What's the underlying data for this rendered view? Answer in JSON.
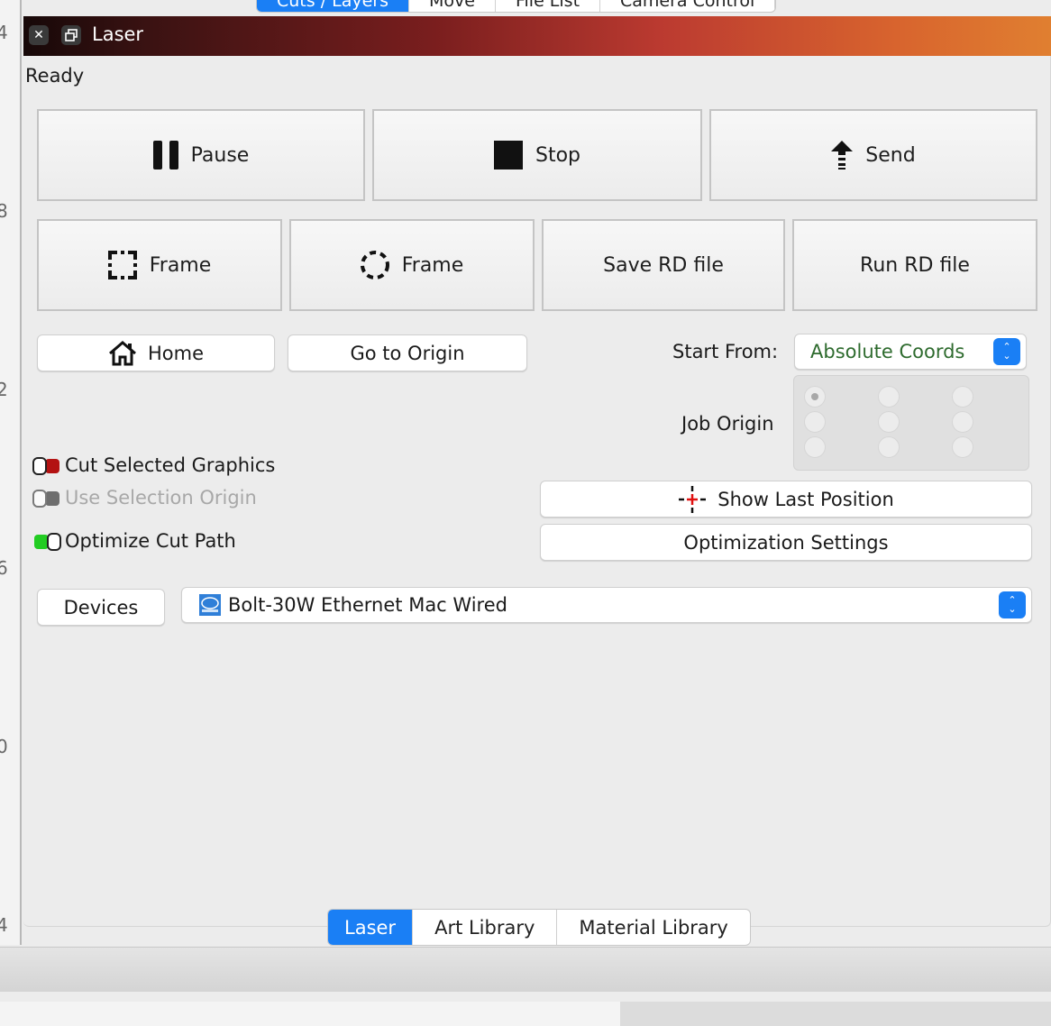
{
  "ruler": {
    "ticks": [
      "4",
      "8",
      "2",
      "6",
      "0",
      "4"
    ]
  },
  "top_tabs": [
    "Cuts / Layers",
    "Move",
    "File List",
    "Camera Control"
  ],
  "window": {
    "title": "Laser"
  },
  "status": "Ready",
  "job_buttons": {
    "pause": "Pause",
    "stop": "Stop",
    "send": "Send"
  },
  "frame_buttons": {
    "frame_rect": "Frame",
    "frame_circle": "Frame",
    "save_rd": "Save RD file",
    "run_rd": "Run RD file"
  },
  "nav_buttons": {
    "home": "Home",
    "go_to_origin": "Go to Origin"
  },
  "start_from": {
    "label": "Start From:",
    "value": "Absolute Coords"
  },
  "job_origin": {
    "label": "Job Origin",
    "selected": "top-left"
  },
  "options": {
    "cut_selected": {
      "label": "Cut Selected Graphics",
      "state": "off",
      "color": "#b31212"
    },
    "use_selection_origin": {
      "label": "Use Selection Origin",
      "state": "off",
      "disabled": true
    },
    "optimize_cut_path": {
      "label": "Optimize Cut Path",
      "state": "on",
      "color": "#22cc22"
    }
  },
  "right_buttons": {
    "show_last_position": "Show Last Position",
    "optimization_settings": "Optimization Settings"
  },
  "devices": {
    "button": "Devices",
    "selected": "Bolt-30W Ethernet Mac Wired",
    "icon": "rd-controller-icon"
  },
  "bottom_tabs": [
    "Laser",
    "Art Library",
    "Material Library"
  ],
  "colors": {
    "accent": "#1a7ff5",
    "coords_text": "#2e6b2e"
  }
}
